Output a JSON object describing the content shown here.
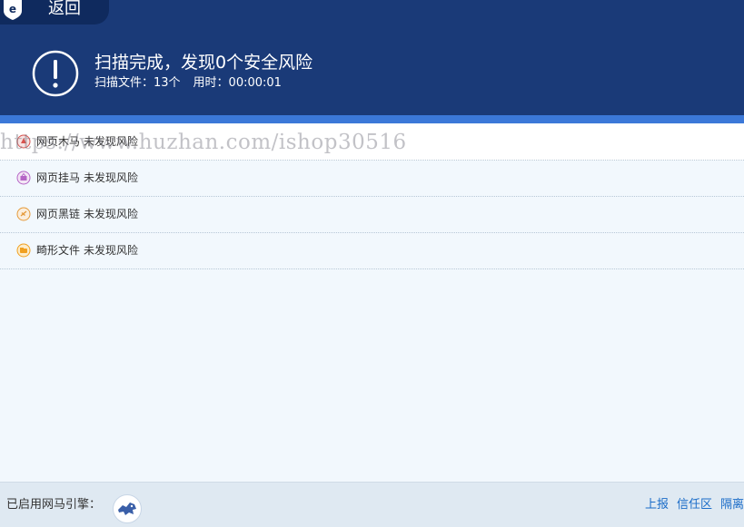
{
  "header": {
    "back_label": "返回",
    "result_title": "扫描完成，发现0个安全风险",
    "scan_files": "扫描文件：13个",
    "elapsed": "用时：00:00:01"
  },
  "results": [
    {
      "category": "网页木马",
      "status": "未发现风险",
      "icon": "trojan-icon"
    },
    {
      "category": "网页挂马",
      "status": "未发现风险",
      "icon": "hanging-horse-icon"
    },
    {
      "category": "网页黑链",
      "status": "未发现风险",
      "icon": "black-link-icon"
    },
    {
      "category": "畸形文件",
      "status": "未发现风险",
      "icon": "malformed-file-icon"
    }
  ],
  "watermark": "https://www.huzhan.com/ishop30516",
  "footer": {
    "engine_label": "已启用网马引擎：",
    "links": [
      "上报",
      "信任区",
      "隔离"
    ]
  },
  "colors": {
    "header_bg": "#1a3a78",
    "accent": "#3b78d8",
    "body_bg": "#f2f8fd",
    "link": "#1a6cc8"
  }
}
